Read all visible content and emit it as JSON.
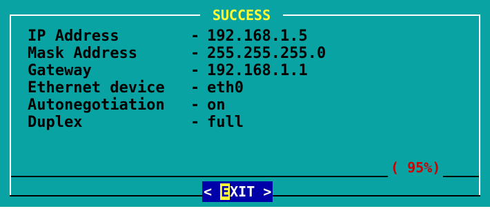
{
  "dialog": {
    "title": "SUCCESS",
    "rows": [
      {
        "label": "IP Address",
        "sep": "-",
        "value": "192.168.1.5"
      },
      {
        "label": "Mask Address",
        "sep": "-",
        "value": "255.255.255.0"
      },
      {
        "label": "Gateway",
        "sep": "-",
        "value": "192.168.1.1"
      },
      {
        "label": "Ethernet device",
        "sep": "-",
        "value": "eth0"
      },
      {
        "label": "Autonegotiation",
        "sep": "-",
        "value": "on"
      },
      {
        "label": "Duplex",
        "sep": "-",
        "value": "full"
      }
    ],
    "progress_text": "( 95%)",
    "progress_percent": 95,
    "exit_button": {
      "left_bracket": "<",
      "hotkey": "E",
      "rest": "XIT",
      "right_bracket": ">"
    }
  },
  "colors": {
    "dialog_background": "#0aa3a3",
    "title_text": "#ffff33",
    "progress_text": "#cc0000",
    "button_background": "#0000a8",
    "button_text": "#ffffff",
    "hotkey_highlight": "#ffff33"
  }
}
